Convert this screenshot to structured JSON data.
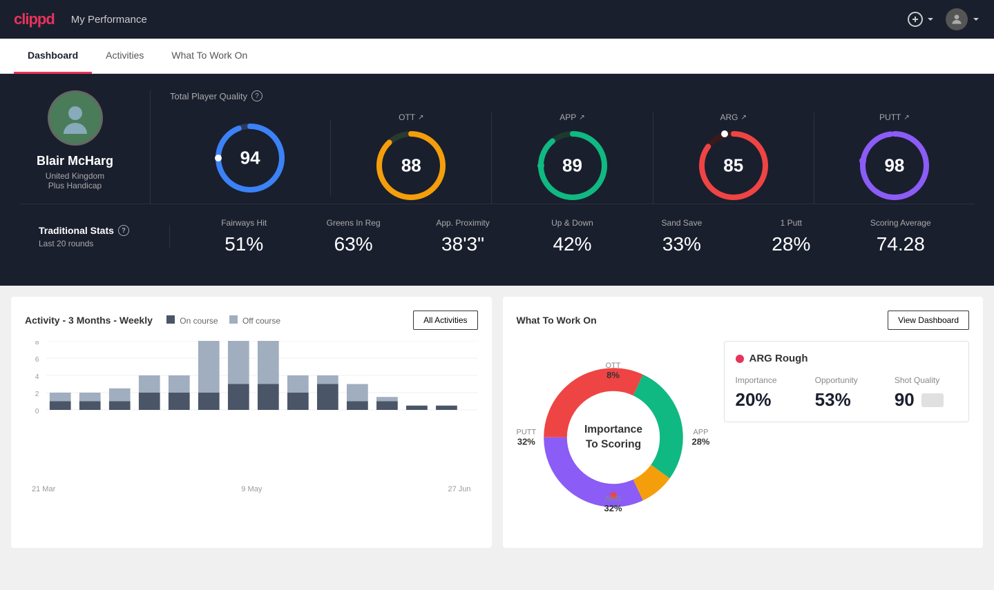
{
  "app": {
    "logo": "clippd",
    "nav_title": "My Performance"
  },
  "tabs": [
    {
      "label": "Dashboard",
      "active": true
    },
    {
      "label": "Activities",
      "active": false
    },
    {
      "label": "What To Work On",
      "active": false
    }
  ],
  "player": {
    "name": "Blair McHarg",
    "country": "United Kingdom",
    "handicap": "Plus Handicap",
    "avatar_emoji": "🧍"
  },
  "total_quality": {
    "label": "Total Player Quality",
    "value": 94,
    "color": "#3b82f6",
    "percentage": 94
  },
  "scores": [
    {
      "label": "OTT",
      "value": 88,
      "color": "#f59e0b",
      "percentage": 88
    },
    {
      "label": "APP",
      "value": 89,
      "color": "#10b981",
      "percentage": 89
    },
    {
      "label": "ARG",
      "value": 85,
      "color": "#ef4444",
      "percentage": 85
    },
    {
      "label": "PUTT",
      "value": 98,
      "color": "#8b5cf6",
      "percentage": 98
    }
  ],
  "traditional_stats": {
    "label": "Traditional Stats",
    "sublabel": "Last 20 rounds",
    "items": [
      {
        "name": "Fairways Hit",
        "value": "51%"
      },
      {
        "name": "Greens In Reg",
        "value": "63%"
      },
      {
        "name": "App. Proximity",
        "value": "38'3\""
      },
      {
        "name": "Up & Down",
        "value": "42%"
      },
      {
        "name": "Sand Save",
        "value": "33%"
      },
      {
        "name": "1 Putt",
        "value": "28%"
      },
      {
        "name": "Scoring Average",
        "value": "74.28"
      }
    ]
  },
  "activity_chart": {
    "title": "Activity - 3 Months - Weekly",
    "legend": [
      {
        "label": "On course",
        "color": "#4a5568"
      },
      {
        "label": "Off course",
        "color": "#a0aec0"
      }
    ],
    "all_activities_btn": "All Activities",
    "x_labels": [
      "21 Mar",
      "9 May",
      "27 Jun"
    ],
    "bars": [
      {
        "on": 1,
        "off": 1
      },
      {
        "on": 1,
        "off": 1
      },
      {
        "on": 1,
        "off": 1.5
      },
      {
        "on": 2,
        "off": 2
      },
      {
        "on": 2,
        "off": 2
      },
      {
        "on": 2,
        "off": 6
      },
      {
        "on": 3,
        "off": 6
      },
      {
        "on": 3,
        "off": 5
      },
      {
        "on": 2,
        "off": 2
      },
      {
        "on": 3,
        "off": 1
      },
      {
        "on": 1,
        "off": 2
      },
      {
        "on": 1,
        "off": 0.5
      },
      {
        "on": 0.5,
        "off": 0
      },
      {
        "on": 0.5,
        "off": 0
      }
    ],
    "y_max": 8
  },
  "what_to_work_on": {
    "title": "What To Work On",
    "view_dashboard_btn": "View Dashboard",
    "donut_center": [
      "Importance",
      "To Scoring"
    ],
    "segments": [
      {
        "label": "OTT",
        "pct": "8%",
        "color": "#f59e0b",
        "value": 8
      },
      {
        "label": "APP",
        "pct": "28%",
        "color": "#10b981",
        "value": 28
      },
      {
        "label": "ARG",
        "pct": "32%",
        "color": "#ef4444",
        "value": 32
      },
      {
        "label": "PUTT",
        "pct": "32%",
        "color": "#8b5cf6",
        "value": 32
      }
    ],
    "detail": {
      "name": "ARG Rough",
      "metrics": [
        {
          "label": "Importance",
          "value": "20%"
        },
        {
          "label": "Opportunity",
          "value": "53%"
        },
        {
          "label": "Shot Quality",
          "value": "90"
        }
      ]
    }
  }
}
